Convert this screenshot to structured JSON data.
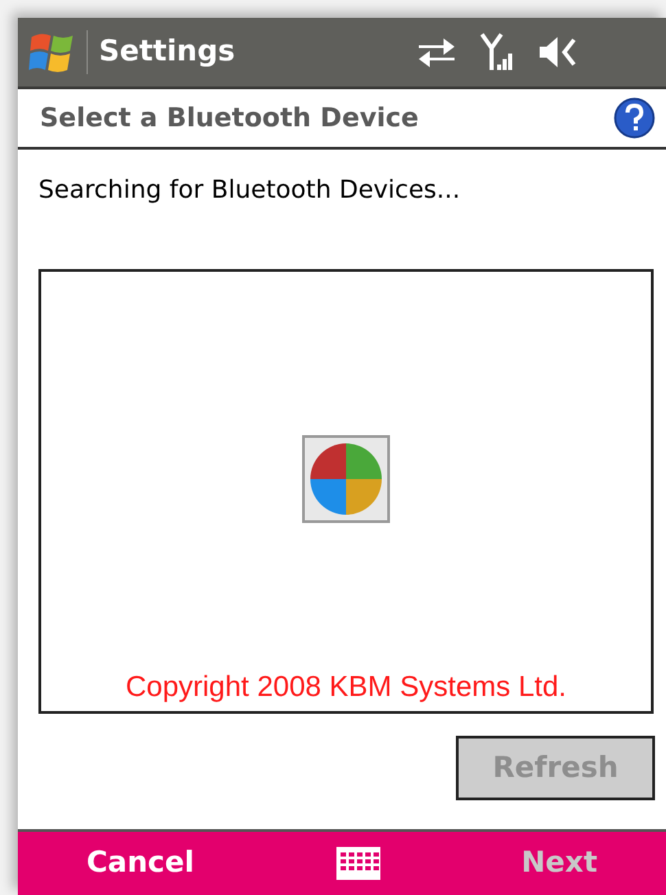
{
  "title_bar": {
    "title": "Settings"
  },
  "header": {
    "title": "Select a Bluetooth Device"
  },
  "status_text": "Searching for Bluetooth Devices...",
  "device_list": {
    "copyright": "Copyright 2008 KBM Systems Ltd."
  },
  "refresh_button": {
    "label": "Refresh",
    "disabled": true
  },
  "softkeys": [
    {
      "label": "Cancel",
      "disabled": false
    },
    {
      "label": "Next",
      "disabled": true
    }
  ]
}
